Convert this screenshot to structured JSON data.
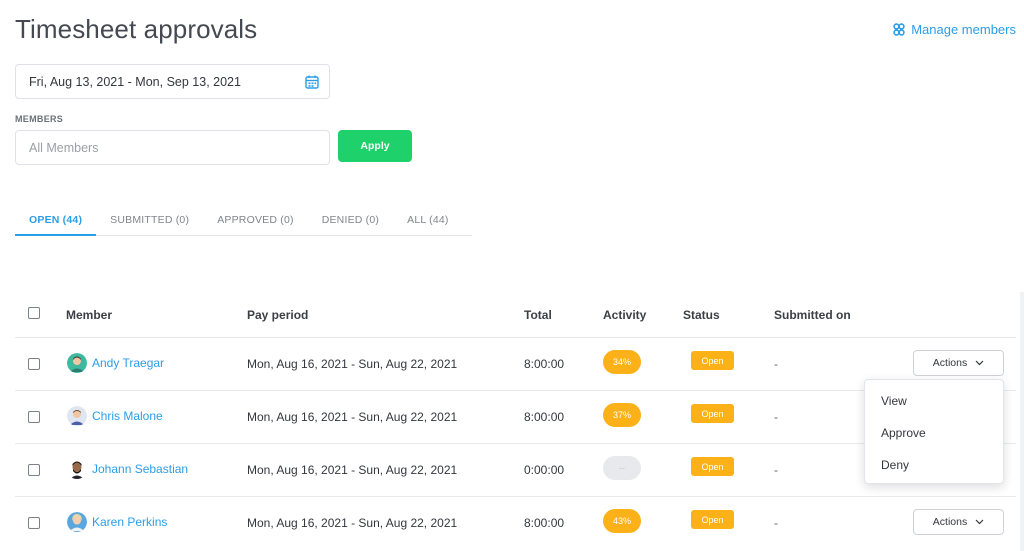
{
  "header": {
    "title": "Timesheet approvals",
    "manage_members": "Manage members"
  },
  "filters": {
    "date_range": "Fri, Aug 13, 2021 - Mon, Sep 13, 2021",
    "members_label": "MEMBERS",
    "members_placeholder": "All Members",
    "apply_label": "Apply"
  },
  "tabs": [
    {
      "label": "OPEN (44)",
      "active": true
    },
    {
      "label": "SUBMITTED (0)",
      "active": false
    },
    {
      "label": "APPROVED (0)",
      "active": false
    },
    {
      "label": "DENIED (0)",
      "active": false
    },
    {
      "label": "ALL (44)",
      "active": false
    }
  ],
  "table": {
    "columns": [
      "Member",
      "Pay period",
      "Total",
      "Activity",
      "Status",
      "Submitted on"
    ],
    "rows": [
      {
        "member": "Andy Traegar",
        "pay_period": "Mon, Aug 16, 2021 - Sun, Aug 22, 2021",
        "total": "8:00:00",
        "activity": "34%",
        "status": "Open",
        "submitted_on": "-",
        "actions": "Actions"
      },
      {
        "member": "Chris Malone",
        "pay_period": "Mon, Aug 16, 2021 - Sun, Aug 22, 2021",
        "total": "8:00:00",
        "activity": "37%",
        "status": "Open",
        "submitted_on": "-",
        "actions": ""
      },
      {
        "member": "Johann Sebastian",
        "pay_period": "Mon, Aug 16, 2021 - Sun, Aug 22, 2021",
        "total": "0:00:00",
        "activity": "--",
        "status": "Open",
        "submitted_on": "-",
        "actions": ""
      },
      {
        "member": "Karen Perkins",
        "pay_period": "Mon, Aug 16, 2021 - Sun, Aug 22, 2021",
        "total": "8:00:00",
        "activity": "43%",
        "status": "Open",
        "submitted_on": "-",
        "actions": "Actions"
      }
    ]
  },
  "actions_menu": {
    "items": [
      "View",
      "Approve",
      "Deny"
    ]
  },
  "colors": {
    "accent": "#2b9ee8",
    "apply_green": "#1fd16a",
    "status_orange": "#fbb117"
  },
  "icons": [
    "people-icon",
    "calendar-icon",
    "chevron-down-icon"
  ]
}
